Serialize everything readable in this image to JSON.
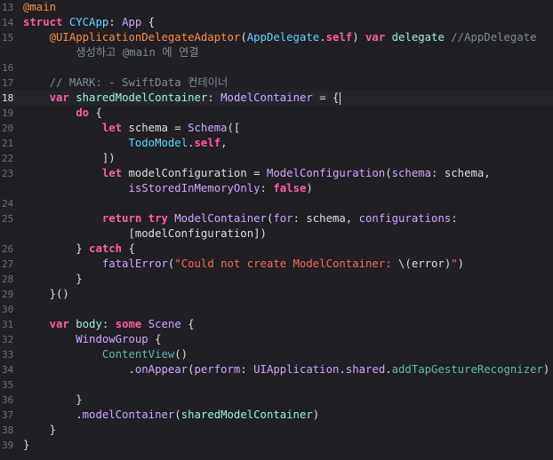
{
  "lines": [
    {
      "n": "13",
      "segs": [
        [
          "attr",
          "@main"
        ]
      ]
    },
    {
      "n": "14",
      "segs": [
        [
          "kw",
          "struct "
        ],
        [
          "projtype",
          "CYCApp"
        ],
        [
          "plain",
          ": "
        ],
        [
          "type",
          "App"
        ],
        [
          "plain",
          " {"
        ]
      ]
    },
    {
      "n": "15",
      "segs": [
        [
          "plain",
          "    "
        ],
        [
          "attr",
          "@UIApplicationDelegateAdaptor"
        ],
        [
          "plain",
          "("
        ],
        [
          "projtype",
          "AppDelegate"
        ],
        [
          "plain",
          "."
        ],
        [
          "kw",
          "self"
        ],
        [
          "plain",
          ") "
        ],
        [
          "kw",
          "var "
        ],
        [
          "proj",
          "delegate"
        ],
        [
          "plain",
          " "
        ],
        [
          "com",
          "//AppDelegate"
        ]
      ]
    },
    {
      "n": "",
      "segs": [
        [
          "com",
          "        생성하고 @main 에 연결"
        ]
      ]
    },
    {
      "n": "16",
      "segs": []
    },
    {
      "n": "17",
      "segs": [
        [
          "plain",
          "    "
        ],
        [
          "com",
          "// MARK: - SwiftData 컨테이너"
        ]
      ]
    },
    {
      "n": "18",
      "current": true,
      "segs": [
        [
          "plain",
          "    "
        ],
        [
          "kw",
          "var "
        ],
        [
          "proj",
          "sharedModelContainer"
        ],
        [
          "plain",
          ": "
        ],
        [
          "type",
          "ModelContainer"
        ],
        [
          "plain",
          " = {"
        ]
      ]
    },
    {
      "n": "19",
      "segs": [
        [
          "plain",
          "        "
        ],
        [
          "kw",
          "do"
        ],
        [
          "plain",
          " {"
        ]
      ]
    },
    {
      "n": "20",
      "segs": [
        [
          "plain",
          "            "
        ],
        [
          "kw",
          "let "
        ],
        [
          "plain",
          "schema = "
        ],
        [
          "type",
          "Schema"
        ],
        [
          "plain",
          "(["
        ]
      ]
    },
    {
      "n": "21",
      "segs": [
        [
          "plain",
          "                "
        ],
        [
          "projtype",
          "TodoModel"
        ],
        [
          "plain",
          "."
        ],
        [
          "kw",
          "self"
        ],
        [
          "plain",
          ","
        ]
      ]
    },
    {
      "n": "22",
      "segs": [
        [
          "plain",
          "            ])"
        ]
      ]
    },
    {
      "n": "23",
      "segs": [
        [
          "plain",
          "            "
        ],
        [
          "kw",
          "let "
        ],
        [
          "plain",
          "modelConfiguration = "
        ],
        [
          "type",
          "ModelConfiguration"
        ],
        [
          "plain",
          "("
        ],
        [
          "type",
          "schema"
        ],
        [
          "plain",
          ": schema,"
        ]
      ]
    },
    {
      "n": "",
      "segs": [
        [
          "plain",
          "                "
        ],
        [
          "type",
          "isStoredInMemoryOnly"
        ],
        [
          "plain",
          ": "
        ],
        [
          "kw",
          "false"
        ],
        [
          "plain",
          ")"
        ]
      ]
    },
    {
      "n": "24",
      "segs": []
    },
    {
      "n": "25",
      "segs": [
        [
          "plain",
          "            "
        ],
        [
          "kw",
          "return try "
        ],
        [
          "type",
          "ModelContainer"
        ],
        [
          "plain",
          "("
        ],
        [
          "type",
          "for"
        ],
        [
          "plain",
          ": schema, "
        ],
        [
          "type",
          "configurations"
        ],
        [
          "plain",
          ":"
        ]
      ]
    },
    {
      "n": "",
      "segs": [
        [
          "plain",
          "                [modelConfiguration])"
        ]
      ]
    },
    {
      "n": "26",
      "segs": [
        [
          "plain",
          "        } "
        ],
        [
          "kw",
          "catch"
        ],
        [
          "plain",
          " {"
        ]
      ]
    },
    {
      "n": "27",
      "segs": [
        [
          "plain",
          "            "
        ],
        [
          "type",
          "fatalError"
        ],
        [
          "plain",
          "("
        ],
        [
          "str",
          "\"Could not create ModelContainer: "
        ],
        [
          "plain",
          "\\(error)"
        ],
        [
          "str",
          "\""
        ],
        [
          "plain",
          ")"
        ]
      ]
    },
    {
      "n": "28",
      "segs": [
        [
          "plain",
          "        }"
        ]
      ]
    },
    {
      "n": "29",
      "segs": [
        [
          "plain",
          "    }()"
        ]
      ]
    },
    {
      "n": "30",
      "segs": []
    },
    {
      "n": "31",
      "segs": [
        [
          "plain",
          "    "
        ],
        [
          "kw",
          "var "
        ],
        [
          "proj",
          "body"
        ],
        [
          "plain",
          ": "
        ],
        [
          "kw",
          "some "
        ],
        [
          "type",
          "Scene"
        ],
        [
          "plain",
          " {"
        ]
      ]
    },
    {
      "n": "32",
      "segs": [
        [
          "plain",
          "        "
        ],
        [
          "type",
          "WindowGroup"
        ],
        [
          "plain",
          " {"
        ]
      ]
    },
    {
      "n": "33",
      "segs": [
        [
          "plain",
          "            "
        ],
        [
          "method",
          "ContentView"
        ],
        [
          "plain",
          "()"
        ]
      ]
    },
    {
      "n": "34",
      "segs": [
        [
          "plain",
          "                ."
        ],
        [
          "type",
          "onAppear"
        ],
        [
          "plain",
          "("
        ],
        [
          "type",
          "perform"
        ],
        [
          "plain",
          ": "
        ],
        [
          "type",
          "UIApplication"
        ],
        [
          "plain",
          "."
        ],
        [
          "type",
          "shared"
        ],
        [
          "plain",
          "."
        ],
        [
          "method",
          "addTapGestureRecognizer"
        ],
        [
          "plain",
          ")"
        ]
      ]
    },
    {
      "n": "35",
      "segs": []
    },
    {
      "n": "36",
      "segs": [
        [
          "plain",
          "        }"
        ]
      ]
    },
    {
      "n": "37",
      "segs": [
        [
          "plain",
          "        ."
        ],
        [
          "type",
          "modelContainer"
        ],
        [
          "plain",
          "("
        ],
        [
          "proj",
          "sharedModelContainer"
        ],
        [
          "plain",
          ")"
        ]
      ]
    },
    {
      "n": "38",
      "segs": [
        [
          "plain",
          "    }"
        ]
      ]
    },
    {
      "n": "39",
      "segs": [
        [
          "plain",
          "}"
        ]
      ]
    }
  ]
}
